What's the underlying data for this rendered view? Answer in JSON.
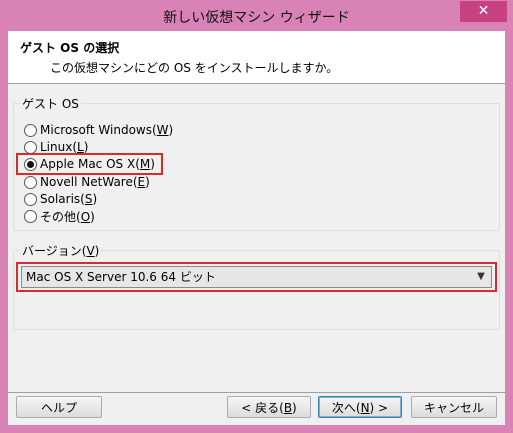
{
  "window": {
    "title": "新しい仮想マシン ウィザード",
    "close_symbol": "✕"
  },
  "header": {
    "title": "ゲスト OS の選択",
    "description": "この仮想マシンにどの OS をインストールしますか。"
  },
  "guest_os": {
    "group_label": "ゲスト OS",
    "options": [
      {
        "label": "Microsoft Windows(",
        "key": "W",
        "suffix": ")",
        "checked": false
      },
      {
        "label": "Linux(",
        "key": "L",
        "suffix": ")",
        "checked": false
      },
      {
        "label": "Apple Mac OS X(",
        "key": "M",
        "suffix": ")",
        "checked": true
      },
      {
        "label": "Novell NetWare(",
        "key": "E",
        "suffix": ")",
        "checked": false
      },
      {
        "label": "Solaris(",
        "key": "S",
        "suffix": ")",
        "checked": false
      },
      {
        "label": "その他(",
        "key": "O",
        "suffix": ")",
        "checked": false
      }
    ]
  },
  "version": {
    "group_label_prefix": "バージョン(",
    "group_label_key": "V",
    "group_label_suffix": ")",
    "selected": "Mac OS X Server 10.6 64 ビット"
  },
  "buttons": {
    "help": "ヘルプ",
    "back_prefix": "< 戻る(",
    "back_key": "B",
    "back_suffix": ")",
    "next_prefix": "次へ(",
    "next_key": "N",
    "next_suffix": ") >",
    "cancel": "キャンセル"
  },
  "colors": {
    "window_frame": "#d982b6",
    "close_button": "#c7437f",
    "highlight": "#d82c2c"
  }
}
